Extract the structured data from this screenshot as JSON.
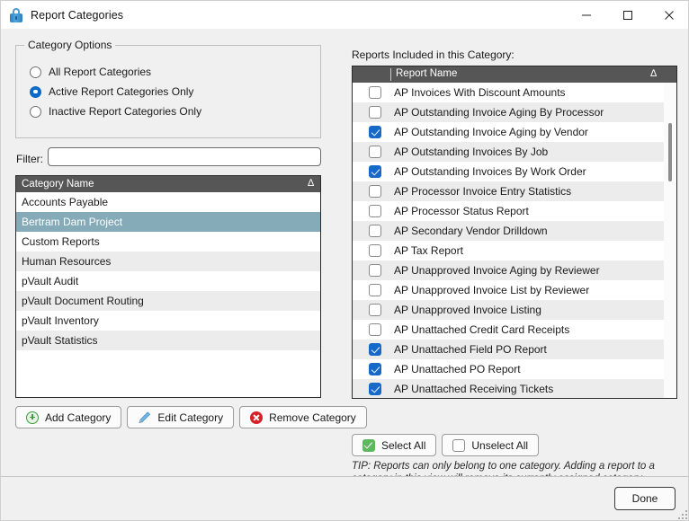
{
  "window": {
    "title": "Report Categories",
    "icon": "lock-icon",
    "controls": {
      "minimize": "minimize-icon",
      "maximize": "maximize-icon",
      "close": "close-icon"
    }
  },
  "category_options": {
    "legend": "Category Options",
    "radios": [
      {
        "label": "All Report Categories",
        "checked": false
      },
      {
        "label": "Active Report Categories Only",
        "checked": true
      },
      {
        "label": "Inactive Report Categories Only",
        "checked": false
      }
    ]
  },
  "filter": {
    "label": "Filter:",
    "value": "",
    "placeholder": ""
  },
  "category_list": {
    "header": "Category Name",
    "sort_indicator": "∆",
    "items": [
      {
        "name": "Accounts Payable",
        "selected": false
      },
      {
        "name": "Bertram Dam Project",
        "selected": true
      },
      {
        "name": "Custom Reports",
        "selected": false
      },
      {
        "name": "Human Resources",
        "selected": false
      },
      {
        "name": "pVault Audit",
        "selected": false
      },
      {
        "name": "pVault Document Routing",
        "selected": false
      },
      {
        "name": "pVault Inventory",
        "selected": false
      },
      {
        "name": "pVault Statistics",
        "selected": false
      }
    ]
  },
  "category_buttons": [
    {
      "label": "Add Category",
      "icon": "plus-circle-icon"
    },
    {
      "label": "Edit Category",
      "icon": "pencil-icon"
    },
    {
      "label": "Remove Category",
      "icon": "remove-circle-icon"
    }
  ],
  "reports_panel": {
    "label": "Reports Included in this Category:",
    "header": "Report Name",
    "sort_indicator": "∆",
    "rows": [
      {
        "name": "AP Invoices With Discount Amounts",
        "checked": false
      },
      {
        "name": "AP Outstanding Invoice Aging By Processor",
        "checked": false
      },
      {
        "name": "AP Outstanding Invoice Aging by Vendor",
        "checked": true
      },
      {
        "name": "AP Outstanding Invoices By Job",
        "checked": false
      },
      {
        "name": "AP Outstanding Invoices By Work Order",
        "checked": true
      },
      {
        "name": "AP Processor Invoice Entry Statistics",
        "checked": false
      },
      {
        "name": "AP Processor Status Report",
        "checked": false
      },
      {
        "name": "AP Secondary Vendor Drilldown",
        "checked": false
      },
      {
        "name": "AP Tax Report",
        "checked": false
      },
      {
        "name": "AP Unapproved Invoice Aging by Reviewer",
        "checked": false
      },
      {
        "name": "AP Unapproved Invoice List by Reviewer",
        "checked": false
      },
      {
        "name": "AP Unapproved Invoice Listing",
        "checked": false
      },
      {
        "name": "AP Unattached Credit Card Receipts",
        "checked": false
      },
      {
        "name": "AP Unattached Field PO Report",
        "checked": true
      },
      {
        "name": "AP Unattached PO Report",
        "checked": true
      },
      {
        "name": "AP Unattached Receiving Tickets",
        "checked": true
      }
    ]
  },
  "selection_buttons": [
    {
      "label": "Select All",
      "icon": "checkbox-checked-icon"
    },
    {
      "label": "Unselect All",
      "icon": "checkbox-empty-icon"
    }
  ],
  "tip": "TIP:  Reports can only belong to one category.  Adding a report to a category in this view will remove its currently assigned category.",
  "footer": {
    "done_label": "Done"
  },
  "colors": {
    "accent_blue": "#1669c8",
    "selection": "#85aab8",
    "header_gray": "#565656",
    "row_stripe": "#ececec",
    "green": "#3e9b3e",
    "red": "#d6202a",
    "window_bg": "#f0f0f0"
  }
}
